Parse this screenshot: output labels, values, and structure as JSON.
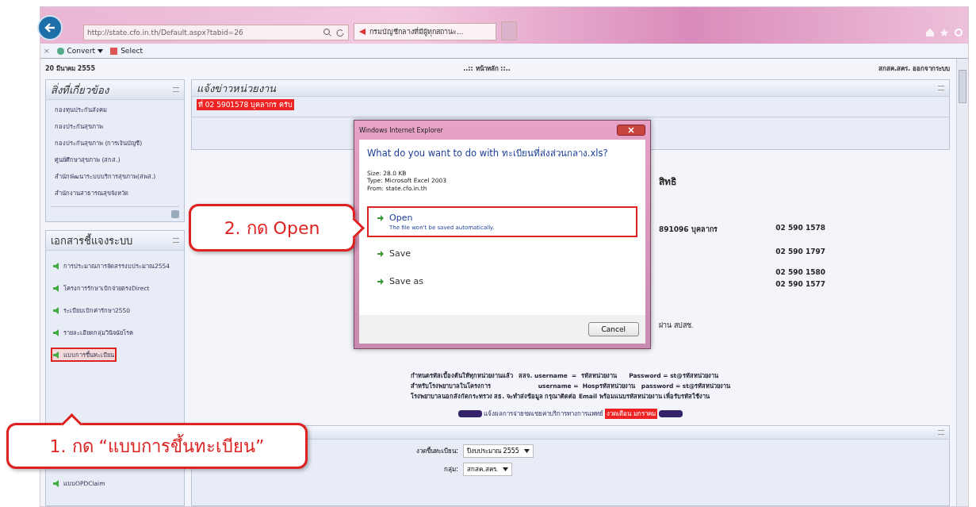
{
  "browser": {
    "url": "http://state.cfo.in.th/Default.aspx?tabid=26",
    "tab_title": "กรมบัญชีกลางที่มีผู้ทุกสถานะ...",
    "toolbar": [
      {
        "kind": "close",
        "label": "×"
      },
      {
        "kind": "convert",
        "label": "Convert"
      },
      {
        "kind": "select",
        "label": "Select"
      }
    ]
  },
  "header": {
    "date": "20 มีนาคม 2555",
    "title": "..:: หน้าหลัก ::..",
    "user": "สกสค.สคร.  ออกจากระบบ"
  },
  "sidebar": {
    "panels": [
      {
        "title": "สิ่งที่เกี่ยวข้อง",
        "kind": "links",
        "items": [
          {
            "label": "กองทุนประกันสังคม",
            "highlighted": false
          },
          {
            "label": "กองประกันสุขภาพ",
            "highlighted": false
          },
          {
            "label": "กองประกันสุขภาพ (การเงินบัญชี)",
            "highlighted": false
          },
          {
            "label": "ศูนย์ศึกษาสุขภาพ (สกส.)",
            "highlighted": false
          },
          {
            "label": "สำนักพัฒนาระบบบริการสุขภาพ(สพส.)",
            "highlighted": false
          },
          {
            "label": "สำนักงานสาธารณสุขจังหวัด",
            "highlighted": false
          }
        ]
      },
      {
        "title": "เอกสารชี้แจงระบบ",
        "kind": "documents",
        "items": [
          {
            "label": "การประมาณการจัดสรรงบประมาณ2554",
            "highlighted": false
          },
          {
            "label": "โครงการรักษาเบิกจ่ายตรงDirect",
            "highlighted": false
          },
          {
            "label": "ระเบียบเบิกค่ารักษา2550",
            "highlighted": false
          },
          {
            "label": "รายละเอียดกลุ่มวินิจฉัยโรค",
            "highlighted": false
          },
          {
            "label": "แบบการขึ้นทะเบียน",
            "highlighted": true
          },
          {
            "label": "แบบOPDClaim",
            "highlighted": false
          }
        ]
      }
    ]
  },
  "news": {
    "title": "แจ้งข่าวหน่วยงาน",
    "highlight": "ที่ 02 5901578 บุคลากร ครับ"
  },
  "contacts": {
    "heading": "สิทธิ",
    "lines": [
      {
        "label": "891096 บุคลากร",
        "number": "02 590 1578"
      },
      {
        "number": "02 590 1797"
      },
      {
        "number": "02 590 1580"
      },
      {
        "number": "02 590 1577"
      }
    ],
    "footer": "ผ่าน สปสช."
  },
  "notice_lines": [
    "กำหนดรหัสเบื้องต้นให้ทุกหน่วยงานแล้ว   สสจ. username  =  รหัสหน่วยงาน      Password = st@รหัสหน่วยงาน",
    "สำหรับโรงพยาบาลในโครงการ                       username =  Hospรหัสหน่วยงาน   password = st@รหัสหน่วยงาน",
    "โรงพยาบาลนอกสังกัดกระทรวง สธ. จะทำส่งข้อมูล กรุณาติดต่อ Email พร้อมแนบรหัสหน่วยงาน เพื่อรับรหัสใช้งาน"
  ],
  "payment_notice": {
    "text": "แจ้งผลการจ่ายชดเชยค่าบริการทางการแพทย์",
    "highlight": "งวดเดือน มกราคม"
  },
  "form": {
    "fields": [
      {
        "label": "งวดขึ้นทะเบียน:",
        "value": "ปีงบประมาณ 2555"
      },
      {
        "label": "กลุ่ม:",
        "value": "สกสค.สคร."
      }
    ]
  },
  "dialog": {
    "title": "Windows Internet Explorer",
    "question": "What do you want to do with ทะเบียนที่ส่งส่วนกลาง.xls?",
    "details": [
      "Size: 28.0 KB",
      "Type: Microsoft Excel 2003",
      "From: state.cfo.in.th"
    ],
    "options": [
      {
        "label": "Open",
        "description": "The file won't be saved automatically.",
        "highlighted": true
      },
      {
        "label": "Save",
        "highlighted": false
      },
      {
        "label": "Save as",
        "highlighted": false
      }
    ],
    "buttons": [
      "Cancel"
    ]
  },
  "callouts": [
    {
      "text": "2. กด Open"
    },
    {
      "text": "1. กด “แบบการขึ้นทะเบียน”"
    }
  ]
}
